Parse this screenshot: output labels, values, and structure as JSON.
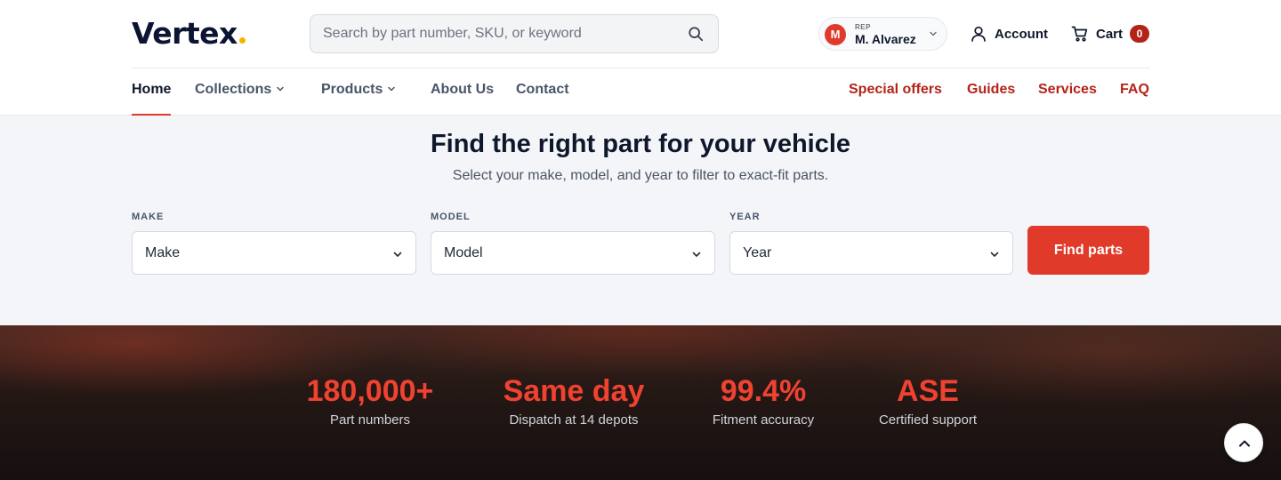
{
  "header": {
    "logo": "Vertex",
    "logo_dot_color": "#f5b400",
    "search_placeholder": "Search by part number, SKU, or keyword",
    "rep": {
      "initial": "M",
      "tag": "REP",
      "name": "M. Alvarez"
    },
    "account_label": "Account",
    "cart_label": "Cart",
    "cart_count": "0"
  },
  "nav": {
    "left": [
      {
        "label": "Home",
        "active": true
      },
      {
        "label": "Collections",
        "dropdown": true
      },
      {
        "label": "Products",
        "dropdown": true
      },
      {
        "label": "About Us"
      },
      {
        "label": "Contact"
      }
    ],
    "right": [
      {
        "label": "Special offers"
      },
      {
        "label": "Guides"
      },
      {
        "label": "Services"
      },
      {
        "label": "FAQ"
      }
    ]
  },
  "finder": {
    "title": "Find the right part for your vehicle",
    "subtitle": "Select your make, model, and year to filter to exact-fit parts.",
    "fields": [
      {
        "label": "MAKE",
        "value": "Make"
      },
      {
        "label": "MODEL",
        "value": "Model"
      },
      {
        "label": "YEAR",
        "value": "Year"
      }
    ],
    "button": "Find parts"
  },
  "stats": [
    {
      "value": "180,000+",
      "label": "Part numbers"
    },
    {
      "value": "Same day",
      "label": "Dispatch at 14 depots"
    },
    {
      "value": "99.4%",
      "label": "Fitment accuracy"
    },
    {
      "value": "ASE",
      "label": "Certified support"
    }
  ],
  "colors": {
    "accent": "#e03a2a",
    "nav_red": "#b42318",
    "navy": "#0f172a"
  },
  "icons": [
    "search-icon",
    "chevron-down-icon",
    "user-icon",
    "cart-icon",
    "chevron-up-icon"
  ]
}
